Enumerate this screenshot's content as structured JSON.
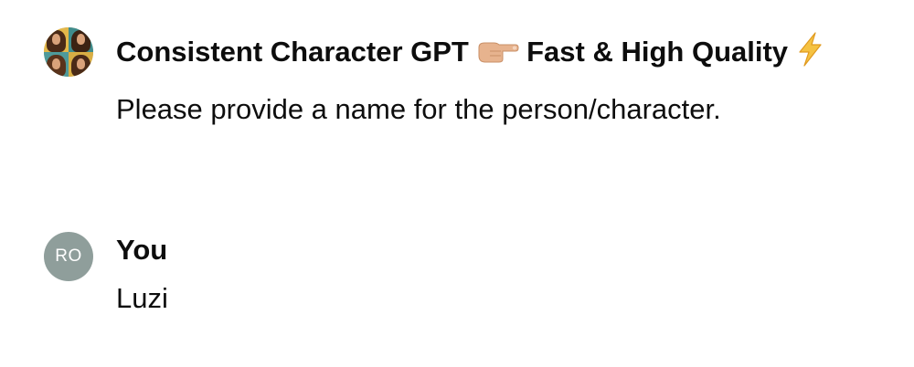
{
  "conversation": {
    "gpt_message": {
      "author": "Consistent Character GPT",
      "author_suffix": "Fast & High Quality",
      "text": "Please provide a name for the person/character."
    },
    "user_message": {
      "avatar_initials": "RO",
      "author": "You",
      "text": "Luzi"
    }
  },
  "colors": {
    "user_avatar_bg": "#8f9e9b",
    "text": "#0d0d0d",
    "bolt": "#f5b82e",
    "finger_skin": "#e7b38e"
  },
  "icons": [
    "gpt-avatar-collage",
    "pointing-finger-icon",
    "lightning-bolt-icon"
  ]
}
